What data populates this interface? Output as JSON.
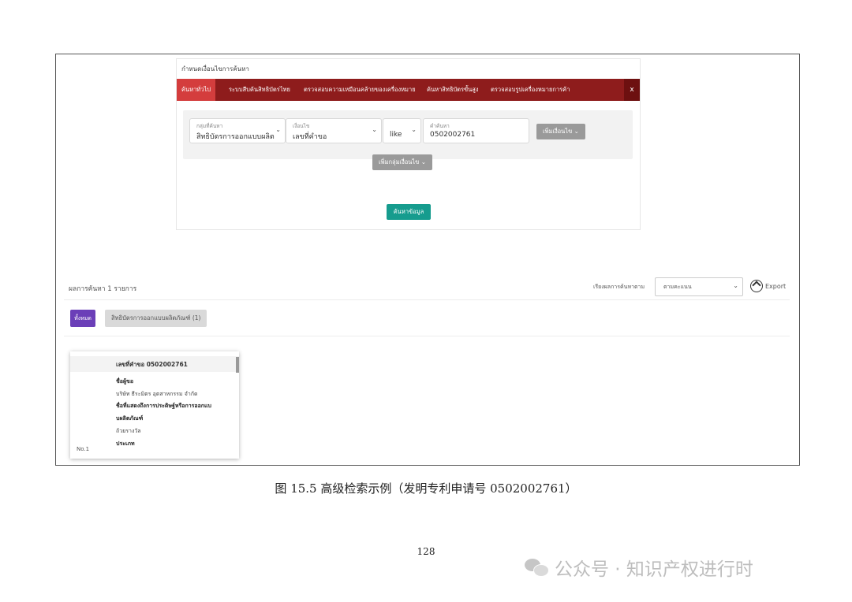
{
  "panel": {
    "title": "กำหนดเงื่อนไขการค้นหา",
    "tabs": [
      "ค้นหาทั่วไป",
      "ระบบสืบค้นสิทธิบัตรไทย",
      "ตรวจสอบความเหมือนคล้ายของเครื่องหมาย",
      "ค้นหาสิทธิบัตรขั้นสูง",
      "ตรวจสอบรูปเครื่องหมายการค้า"
    ],
    "close": "x",
    "fields": {
      "group_label": "กลุ่มที่ค้นหา",
      "group_value": "สิทธิบัตรการออกแบบผลิต",
      "condition_label": "เงื่อนไข",
      "condition_value": "เลขที่คำขอ",
      "operator_value": "like",
      "keyword_label": "คำค้นหา",
      "keyword_value": "0502002761"
    },
    "add_condition": "เพิ่มเงื่อนไข",
    "add_group": "เพิ่มกลุ่มเงื่อนไข",
    "search_button": "ค้นหาข้อมูล"
  },
  "results": {
    "count_text": "ผลการค้นหา  1  รายการ",
    "sort_label": "เรียงผลการค้นหาตาม",
    "sort_value": "ตามคะแนน",
    "export": "Export",
    "filter_all": "ทั้งหมด",
    "filter_chip": "สิทธิบัตรการออกแบบผลิตภัณฑ์ (1)"
  },
  "card": {
    "header": "เลขที่คำขอ 0502002761",
    "applicant_label": "ชื่อผู้ขอ",
    "applicant_value": "บริษัท ธีระมิตร อุตสาหกรรม จำกัด",
    "title_label_1": "ชื่อที่แสดงถึงการประดิษฐ์หรือการออกแบ",
    "title_label_2": "บผลิตภัณฑ์",
    "title_value": "ถ้วยรางวัล",
    "type_label": "ประเภท",
    "number": "No.1"
  },
  "caption": "图 15.5  高级检索示例（发明专利申请号 0502002761）",
  "page_number": "128",
  "watermark": "公众号 · 知识产权进行时"
}
